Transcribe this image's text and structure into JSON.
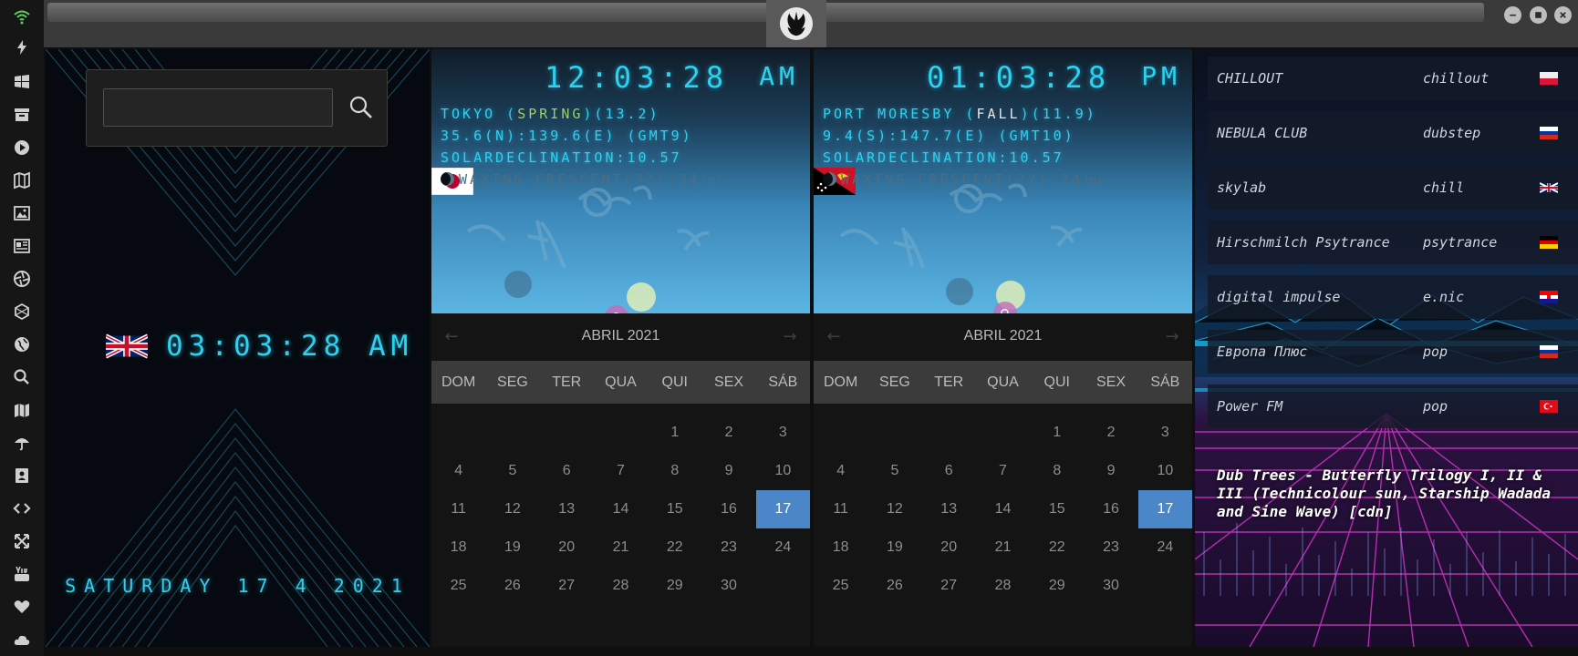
{
  "search": {
    "placeholder": "",
    "value": ""
  },
  "main_clock": {
    "time": "03:03:28 AM",
    "date": "SATURDAY 17 4 2021",
    "flag": "united-kingdom"
  },
  "cities": [
    {
      "flag": "japan",
      "time": "12:03:28",
      "ampm": "AM",
      "name": "TOKYO",
      "season": "SPRING",
      "temp": "13.2",
      "coords": "35.6(N):139.6(E) (GMT9)",
      "solar": "SOLARDECLINATION:10.57",
      "moon": "WAXING CRESCENT(22):24",
      "moon_suffix": "(n)",
      "calendar": {
        "month": "ABRIL 2021",
        "weekdays": [
          "DOM",
          "SEG",
          "TER",
          "QUA",
          "QUI",
          "SEX",
          "SÁB"
        ],
        "days": [
          "",
          "",
          "",
          "",
          "1",
          "2",
          "3",
          "4",
          "5",
          "6",
          "7",
          "8",
          "9",
          "10",
          "11",
          "12",
          "13",
          "14",
          "15",
          "16",
          "17",
          "18",
          "19",
          "20",
          "21",
          "22",
          "23",
          "24",
          "25",
          "26",
          "27",
          "28",
          "29",
          "30",
          ""
        ],
        "today": "17"
      }
    },
    {
      "flag": "papua-new-guinea",
      "time": "01:03:28",
      "ampm": "PM",
      "name": "PORT MORESBY",
      "season": "FALL",
      "temp": "11.9",
      "coords": "9.4(S):147.7(E) (GMT10)",
      "solar": "SOLARDECLINATION:10.57",
      "moon": "WAXING CRESCENT(22):24",
      "moon_suffix": "(n)",
      "calendar": {
        "month": "ABRIL 2021",
        "weekdays": [
          "DOM",
          "SEG",
          "TER",
          "QUA",
          "QUI",
          "SEX",
          "SÁB"
        ],
        "days": [
          "",
          "",
          "",
          "",
          "1",
          "2",
          "3",
          "4",
          "5",
          "6",
          "7",
          "8",
          "9",
          "10",
          "11",
          "12",
          "13",
          "14",
          "15",
          "16",
          "17",
          "18",
          "19",
          "20",
          "21",
          "22",
          "23",
          "24",
          "25",
          "26",
          "27",
          "28",
          "29",
          "30",
          ""
        ],
        "today": "17"
      }
    }
  ],
  "radio": {
    "stations": [
      {
        "name": "CHILLOUT",
        "genre": "chillout",
        "flag": "poland"
      },
      {
        "name": "NEBULA CLUB",
        "genre": "dubstep",
        "flag": "russia"
      },
      {
        "name": "skylab",
        "genre": "chill",
        "flag": "united-kingdom"
      },
      {
        "name": "Hirschmilch Psytrance",
        "genre": "psytrance",
        "flag": "germany"
      },
      {
        "name": "digital impulse",
        "genre": "e.nic",
        "flag": "croatia"
      },
      {
        "name": "Европа Плюс",
        "genre": "pop",
        "flag": "russia"
      },
      {
        "name": "Power FM",
        "genre": "pop",
        "flag": "turkey"
      }
    ],
    "now_playing": "Dub Trees - Butterfly Trilogy I, II & III (Technicolour sun, Starship Wadada and Sine Wave) [cdn]"
  },
  "sidebar_icons": [
    "wifi-icon",
    "bolt-icon",
    "windows-icon",
    "archive-icon",
    "play-icon",
    "map-book-icon",
    "image-icon",
    "newspaper-icon",
    "aperture-icon",
    "hexagon-icon",
    "globe-icon",
    "search-icon",
    "map-icon",
    "umbrella-icon",
    "contact-icon",
    "code-icon",
    "expand-icon",
    "youtube-icon",
    "heart-icon",
    "cloud-icon"
  ],
  "colors": {
    "lcd": "#2ed1ee",
    "today": "#4a86c8",
    "wifi": "#5fd35f"
  }
}
